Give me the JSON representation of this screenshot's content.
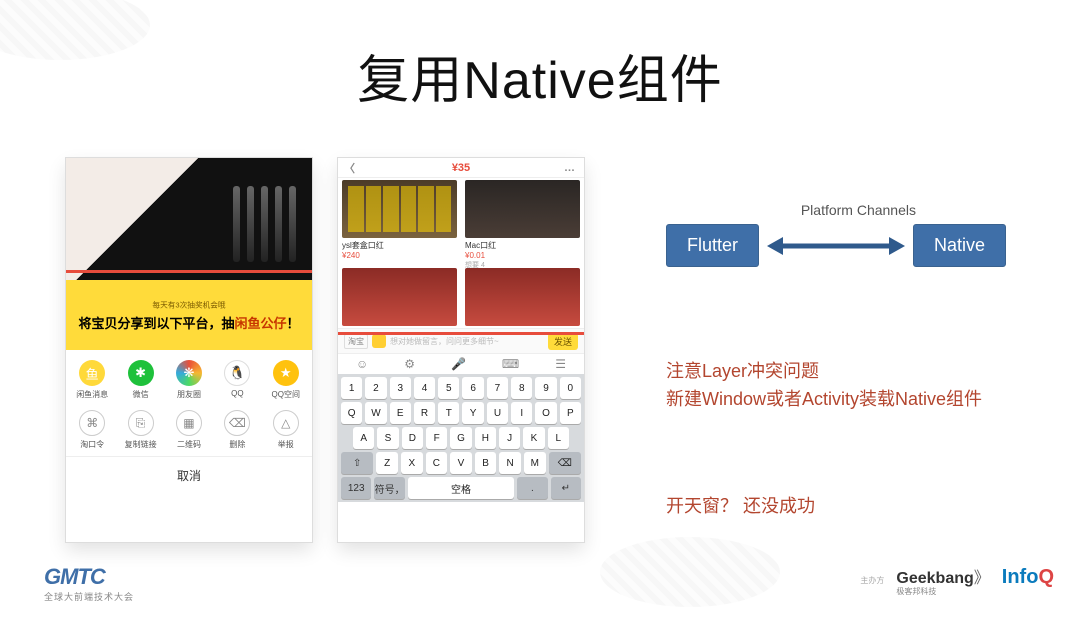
{
  "title": "复用Native组件",
  "diagram": {
    "left": "Flutter",
    "right": "Native",
    "label": "Platform Channels"
  },
  "notes": {
    "line1": "注意Layer冲突问题",
    "line2": "新建Window或者Activity装载Native组件",
    "line3": "开天窗？ 还没成功"
  },
  "phone1": {
    "banner_top": "每天有3次抽奖机会哦",
    "banner_main_1": "将宝贝分享到以下平台，抽",
    "banner_main_hl": "闲鱼公仔",
    "banner_main_2": "！",
    "share": [
      {
        "id": "xy",
        "label": "闲鱼消息",
        "glyph": "鱼"
      },
      {
        "id": "wx",
        "label": "微信",
        "glyph": "✱"
      },
      {
        "id": "pyq",
        "label": "朋友圈",
        "glyph": "❋"
      },
      {
        "id": "qq",
        "label": "QQ",
        "glyph": "🐧"
      },
      {
        "id": "qz",
        "label": "QQ空间",
        "glyph": "★"
      }
    ],
    "utils": [
      {
        "label": "淘口令",
        "glyph": "⌘"
      },
      {
        "label": "复制链接",
        "glyph": "⎘"
      },
      {
        "label": "二维码",
        "glyph": "▦"
      },
      {
        "label": "删除",
        "glyph": "⌫"
      },
      {
        "label": "举报",
        "glyph": "△"
      }
    ],
    "cancel": "取消"
  },
  "phone2": {
    "back": "〈",
    "price": "¥35",
    "dots": "…",
    "cards": [
      {
        "title": "ysl套盒口红",
        "price": "¥240",
        "meta": ""
      },
      {
        "title": "Mac口红",
        "price": "¥0.01",
        "meta": "想要 4"
      },
      {
        "title": "",
        "price": "",
        "meta": ""
      },
      {
        "title": "",
        "price": "",
        "meta": ""
      }
    ],
    "chip": "淘宝",
    "placeholder": "想对她做留言，问问更多细节~",
    "send": "发送",
    "tool_icons": [
      "☺",
      "⚙",
      "🎤",
      "⌨",
      "☰"
    ],
    "kb_rows": [
      [
        "1",
        "2",
        "3",
        "4",
        "5",
        "6",
        "7",
        "8",
        "9",
        "0"
      ],
      [
        "Q",
        "W",
        "E",
        "R",
        "T",
        "Y",
        "U",
        "I",
        "O",
        "P"
      ],
      [
        "A",
        "S",
        "D",
        "F",
        "G",
        "H",
        "J",
        "K",
        "L"
      ],
      [
        "⇧",
        "Z",
        "X",
        "C",
        "V",
        "B",
        "N",
        "M",
        "⌫"
      ],
      [
        "123",
        "符号，",
        "空格",
        ".",
        "↵"
      ]
    ]
  },
  "footer": {
    "gmtc": "GMTC",
    "gmtc_sub": "全球大前端技术大会",
    "sponsor": "主办方",
    "geekbang": "Geekbang",
    "geekbang_sub": "极客邦科技",
    "infoq": "InfoQ"
  }
}
